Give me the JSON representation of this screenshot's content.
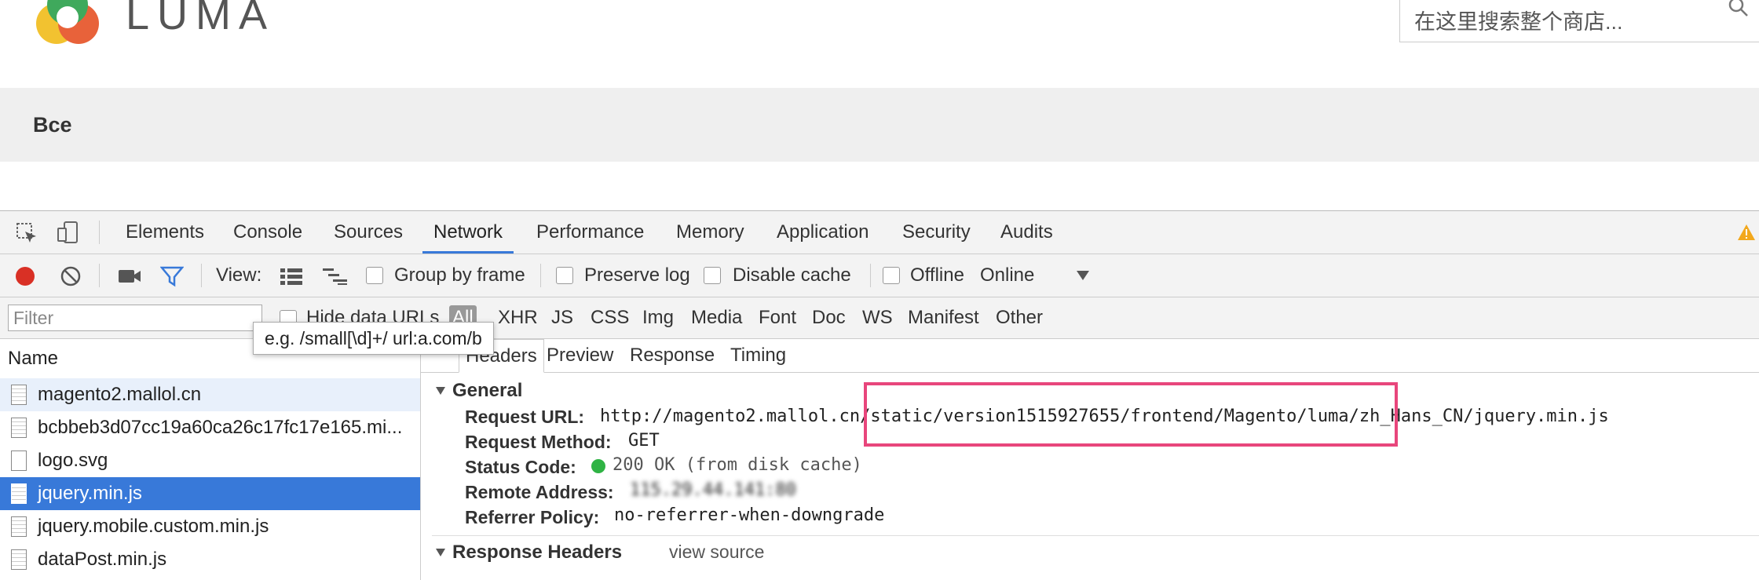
{
  "site": {
    "logo_text": "LUMA",
    "search_placeholder": "在这里搜索整个商店...",
    "breadcrumb": "Все"
  },
  "devtools": {
    "tabs": [
      "Elements",
      "Console",
      "Sources",
      "Network",
      "Performance",
      "Memory",
      "Application",
      "Security",
      "Audits"
    ],
    "active_tab": "Network",
    "toolbar": {
      "view_label": "View:",
      "group_by_frame": "Group by frame",
      "preserve_log": "Preserve log",
      "disable_cache": "Disable cache",
      "offline": "Offline",
      "throttle": "Online"
    },
    "filter": {
      "placeholder": "Filter",
      "hide_data_urls": "Hide data URLs",
      "types": [
        "All",
        "XHR",
        "JS",
        "CSS",
        "Img",
        "Media",
        "Font",
        "Doc",
        "WS",
        "Manifest",
        "Other"
      ],
      "tooltip": "e.g. /small[\\d]+/ url:a.com/b"
    },
    "requests": {
      "header": "Name",
      "rows": [
        {
          "name": "magento2.mallol.cn"
        },
        {
          "name": "bcbbeb3d07cc19a60ca26c17fc17e165.mi..."
        },
        {
          "name": "logo.svg"
        },
        {
          "name": "jquery.min.js"
        },
        {
          "name": "jquery.mobile.custom.min.js"
        },
        {
          "name": "dataPost.min.js"
        }
      ],
      "selected_index": 3
    },
    "detail": {
      "tabs": [
        "Headers",
        "Preview",
        "Response",
        "Timing"
      ],
      "general_title": "General",
      "request_url_label": "Request URL:",
      "request_url": "http://magento2.mallol.cn/static/version1515927655/frontend/Magento/luma/zh_Hans_CN/jquery.min.js",
      "request_method_label": "Request Method:",
      "request_method": "GET",
      "status_code_label": "Status Code:",
      "status_code": "200 OK (from disk cache)",
      "remote_address_label": "Remote Address:",
      "remote_address": "115.29.44.141:80",
      "referrer_policy_label": "Referrer Policy:",
      "referrer_policy": "no-referrer-when-downgrade",
      "response_headers_title": "Response Headers",
      "view_source": "view source"
    },
    "colors": {
      "accent": "#3879d9",
      "record": "#d93025",
      "status_ok": "#2fb344",
      "highlight": "#e8467c",
      "warning": "#f2a81d"
    }
  }
}
